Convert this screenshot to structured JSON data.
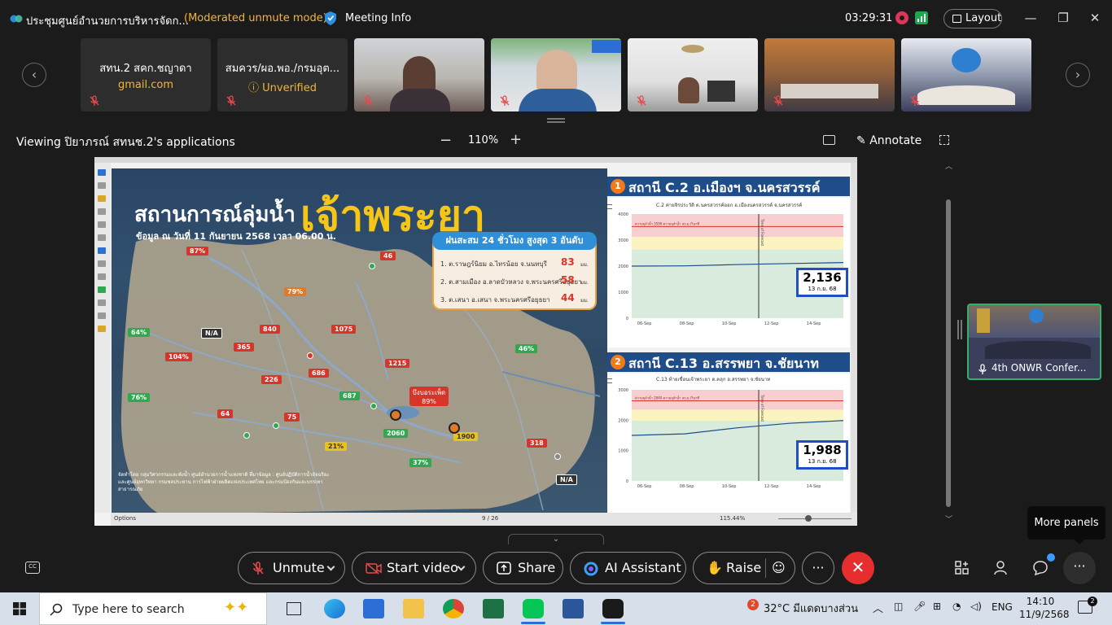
{
  "titlebar": {
    "meeting_title": "ประชุมศูนย์อำนวยการบริหารจัดก...",
    "mode": "(Moderated unmute mode)",
    "meeting_info": "Meeting Info",
    "timer": "03:29:31",
    "layout": "Layout"
  },
  "participants": [
    {
      "name": "สทน.2 สคก.ชญาดา",
      "sub": "gmail.com",
      "sub_color": "#f5b437"
    },
    {
      "name": "สมควร/ผอ.พอ./กรมอุต...",
      "sub": "Unverified",
      "sub_color": "#f5b437"
    }
  ],
  "share": {
    "viewing": "Viewing ปิยาภรณ์  สทนช.2's applications",
    "zoom": "110%",
    "annotate": "Annotate"
  },
  "slide": {
    "title_1": "สถานการณ์ลุ่มน้ำ",
    "title_2": "เจ้าพระยา",
    "subtitle": "ข้อมูล ณ วันที่ 11 กันยายน 2568 เวลา 06.00 น.",
    "rain_title": "ฝนสะสม 24 ชั่วโมง สูงสุด 3 อันดับ",
    "rain_rows": [
      {
        "label": "1. ต.ราษฎร์นิยม อ.ไทรน้อย จ.นนทบุรี",
        "value": "83",
        "unit": "มม."
      },
      {
        "label": "2. ต.สามเมือง อ.ลาดบัวหลวง จ.พระนครศรีอยุธยา",
        "value": "58",
        "unit": "มม."
      },
      {
        "label": "3. ต.เสนา อ.เสนา จ.พระนครศรีอยุธยา",
        "value": "44",
        "unit": "มม."
      }
    ],
    "footer": "จัดทำโดย กลุ่มวิศวกรรมและพังน้ำ ศูนย์อำนวยการน้ำแห่งชาติ ที่มาข้อมูล : ศูนย์ปฏิบัติการน้ำอัจฉริยะและศูนย์อุทกวิทยา กรมชลประทาน การไฟฟ้าฝ่ายผลิตแห่งประเทศไทย และกรมป้องกันและบรรเทาสาธารณภัย",
    "reservoir": "บึงบอระเพ็ด",
    "reservoir_pct": "89%",
    "badges": [
      {
        "text": "87%",
        "color": "#d8352a"
      },
      {
        "text": "79%",
        "color": "#e07a2a"
      },
      {
        "text": "64%",
        "color": "#2fa84f"
      },
      {
        "text": "104%",
        "color": "#d8352a"
      },
      {
        "text": "76%",
        "color": "#2fa84f"
      },
      {
        "text": "46%",
        "color": "#2fa84f"
      },
      {
        "text": "21%",
        "color": "#e8c21f"
      },
      {
        "text": "37%",
        "color": "#2fa84f"
      }
    ],
    "flows": [
      "46",
      "840",
      "1075",
      "365",
      "1215",
      "226",
      "686",
      "687",
      "64",
      "75",
      "2060",
      "1900",
      "318"
    ],
    "na_label": "N/A"
  },
  "station_1": {
    "num": "1",
    "title": "สถานี C.2 อ.เมืองฯ จ.นครสวรรค์",
    "chart_caption": "C.2 ค่ายจิรประวัติ ต.นครสวรรค์ออก อ.เมืองนครสวรรค์ จ.นครสวรรค์",
    "reading": "2,136",
    "reading_date": "13 ก.ย. 68"
  },
  "station_2": {
    "num": "2",
    "title": "สถานี C.13 อ.สรรพยา จ.ชัยนาท",
    "chart_caption": "C.13 ท้ายเขื่อนเจ้าพระยา ต.ตลุก อ.สรรพยา จ.ชัยนาท",
    "reading": "1,988",
    "reading_date": "13 ก.ย. 68"
  },
  "chart_data": [
    {
      "type": "line",
      "title": "C.2 ค่ายจิรประวัติ ต.นครสวรรค์ออก อ.เมืองนครสวรรค์ จ.นครสวรรค์",
      "x": [
        "06-Sep",
        "08-Sep",
        "10-Sep",
        "12-Sep",
        "14-Sep"
      ],
      "ylim": [
        0,
        4000
      ],
      "yticks": [
        "0",
        "1000",
        "2000",
        "3000",
        "4000"
      ],
      "series": [
        {
          "values": [
            2000,
            2010,
            2060,
            2100,
            2136
          ]
        }
      ],
      "annotations": [
        "ความจุลำน้ำ 3590 ความจุลำน้ำ ลบ.ม./วินาที",
        "Time of Forecast"
      ]
    },
    {
      "type": "line",
      "title": "C.13 ท้ายเขื่อนเจ้าพระยา ต.ตลุก อ.สรรพยา จ.ชัยนาท",
      "x": [
        "06-Sep",
        "08-Sep",
        "10-Sep",
        "12-Sep",
        "14-Sep"
      ],
      "ylim": [
        0,
        3000
      ],
      "yticks": [
        "0",
        "1000",
        "2000",
        "3000"
      ],
      "series": [
        {
          "values": [
            1500,
            1550,
            1750,
            1900,
            1988
          ]
        }
      ],
      "annotations": [
        "ความจุลำน้ำ 2840 ความจุลำน้ำ ลบ.ม./วินาที",
        "Time of Forecast"
      ]
    }
  ],
  "doc_status": {
    "page": "9 / 26",
    "zoom": "115.44%",
    "options": "Options"
  },
  "side_tile": {
    "name": "4th ONWR Confer..."
  },
  "tooltip": "More panels",
  "controls": {
    "unmute": "Unmute",
    "start_video": "Start video",
    "share": "Share",
    "ai": "AI Assistant",
    "raise": "Raise"
  },
  "taskbar": {
    "search_placeholder": "Type here to search",
    "weather_badge": "2",
    "weather": "32°C  มีแดดบางส่วน",
    "lang": "ENG",
    "time": "14:10",
    "date": "11/9/2568",
    "notif_count": "2"
  },
  "colors": {
    "accent_red": "#e62e2e",
    "warning": "#f5b437",
    "active_border": "#2fb36b"
  }
}
